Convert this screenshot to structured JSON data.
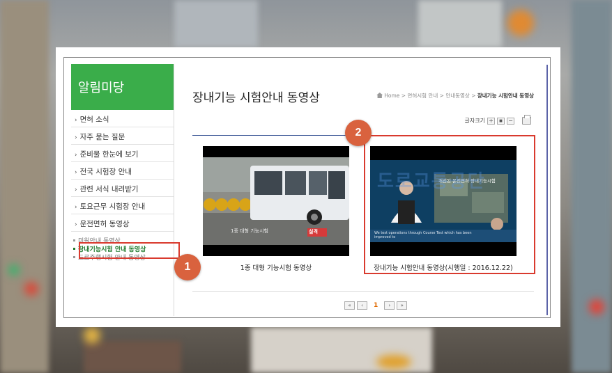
{
  "sidebar": {
    "title": "알림미당",
    "items": [
      {
        "label": "면허 소식"
      },
      {
        "label": "자주 묻는 질문"
      },
      {
        "label": "준비물 한눈에 보기"
      },
      {
        "label": "전국 시험장 안내"
      },
      {
        "label": "관련 서식 내려받기"
      },
      {
        "label": "토요근무 시험장 안내"
      },
      {
        "label": "운전면허 동영상"
      }
    ],
    "sub_items": [
      {
        "label": "미원안내 동영상",
        "active": false
      },
      {
        "label": "장내기능시험 안내 동영상",
        "active": true
      },
      {
        "label": "도로주행시험 안내 동영상",
        "active": false
      }
    ],
    "arrow": "›"
  },
  "page": {
    "title": "장내기능 시험안내 동영상",
    "breadcrumb": {
      "home": "Home",
      "sep1": " > ",
      "level1": "면허시험 안내",
      "sep2": " > ",
      "level2": "안내동영상",
      "sep3": " > ",
      "current": "장내기능 시험안내 동영상"
    },
    "font_size_label": "글자크기",
    "font_buttons": {
      "plus": "+",
      "mid": "■",
      "minus": "−"
    }
  },
  "videos": [
    {
      "caption": "1종 대형 기능시험 동영상",
      "thumb_subtitle": "1종 대형 기능시험",
      "thumb_tag": "실격"
    },
    {
      "caption": "장내기능 시험안내 동영상(시행일 : 2016.12.22)",
      "thumb_headline": "개선된 운전면허 장내기능시험",
      "thumb_subtitle": "We test operations through Course Test which has been improved to",
      "watermark": "도로교통공단"
    }
  ],
  "pagination": {
    "first": "«",
    "prev": "‹",
    "current": "1",
    "next": "›",
    "last": "»"
  },
  "badges": {
    "one": "1",
    "two": "2"
  },
  "colors": {
    "sidebar_green": "#3aad4a",
    "highlight_red": "#d93a2e",
    "badge_orange": "#d9623e",
    "rule_blue": "#2e4c8f"
  }
}
